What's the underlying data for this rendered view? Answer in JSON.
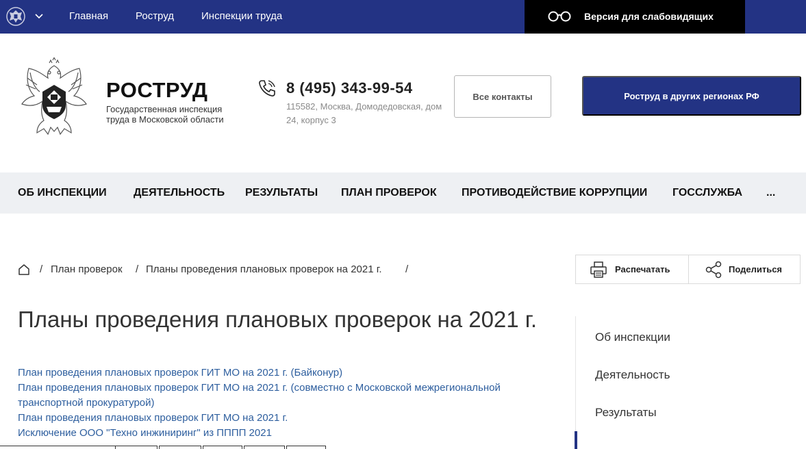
{
  "topbar": {
    "nav": [
      "Главная",
      "Роструд",
      "Инспекции труда"
    ],
    "vision_label": "Версия для слабовидящих",
    "bg_color": "#233384"
  },
  "header": {
    "brand_title": "РОСТРУД",
    "brand_subtitle": "Государственная инспекция труда в Московской области",
    "phone": "8 (495) 343-99-54",
    "address": "115582, Москва, Домодедовская, дом 24, корпус 3",
    "contacts_button": "Все контакты",
    "regions_button": "Роструд в других регионах РФ"
  },
  "mainnav": {
    "items": [
      "ОБ ИНСПЕКЦИИ",
      "ДЕЯТЕЛЬНОСТЬ",
      "РЕЗУЛЬТАТЫ",
      "ПЛАН ПРОВЕРОК",
      "ПРОТИВОДЕЙСТВИЕ КОРРУПЦИИ",
      "ГОССЛУЖБА",
      "..."
    ]
  },
  "breadcrumb": {
    "items": [
      "План проверок",
      "Планы проведения плановых проверок на 2021 г."
    ],
    "separator": "/"
  },
  "tools": {
    "print_label": "Распечатать",
    "share_label": "Поделиться"
  },
  "content": {
    "title": "Планы проведения плановых проверок на 2021 г.",
    "links": [
      "План проведения плановых проверок ГИТ МО на 2021 г. (Байконур)",
      "План проведения плановых проверок ГИТ МО на 2021 г. (совместно с Московской межрегиональной транспортной прокуратурой)",
      "План проведения плановых проверок ГИТ МО на 2021 г.",
      "Исключение ООО \"Техно инжиниринг\" из ПППП 2021"
    ]
  },
  "sidemenu": {
    "items": [
      "Об инспекции",
      "Деятельность",
      "Результаты"
    ]
  }
}
